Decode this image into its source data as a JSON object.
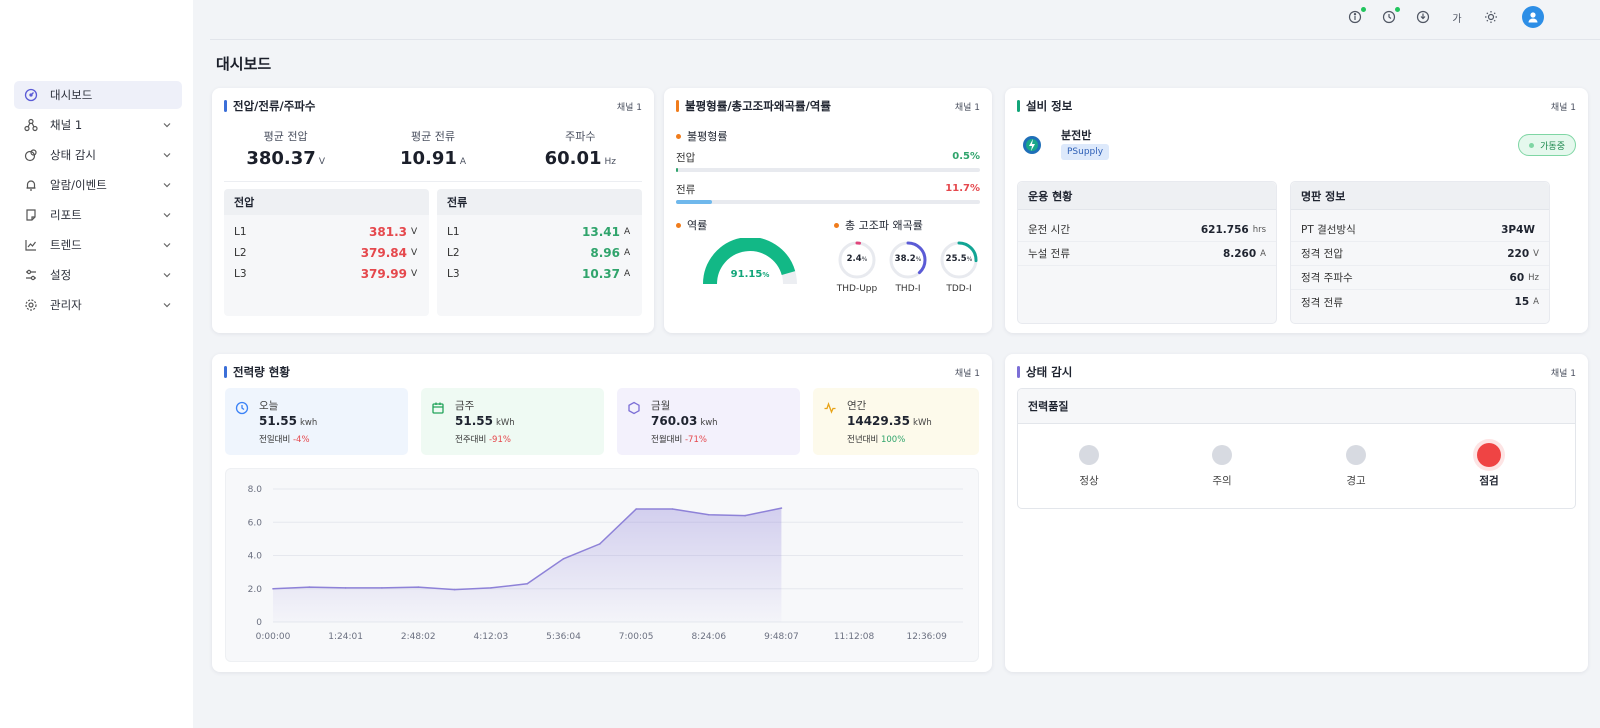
{
  "sidebar": {
    "items": [
      {
        "label": "대시보드",
        "active": true
      },
      {
        "label": "채널 1"
      },
      {
        "label": "상태 감시"
      },
      {
        "label": "알람/이벤트"
      },
      {
        "label": "리포트"
      },
      {
        "label": "트렌드"
      },
      {
        "label": "설정"
      },
      {
        "label": "관리자"
      }
    ]
  },
  "topbar": {
    "lang_label": "가"
  },
  "page_title": "대시보드",
  "vc": {
    "title": "전압/전류/주파수",
    "channel": "채널 1",
    "avg_voltage_label": "평균 전압",
    "avg_voltage": "380.37",
    "avg_voltage_unit": "V",
    "avg_current_label": "평균 전류",
    "avg_current": "10.91",
    "avg_current_unit": "A",
    "freq_label": "주파수",
    "freq": "60.01",
    "freq_unit": "Hz",
    "voltage_header": "전압",
    "current_header": "전류",
    "voltage_rows": [
      {
        "phase": "L1",
        "value": "381.3",
        "unit": "V"
      },
      {
        "phase": "L2",
        "value": "379.84",
        "unit": "V"
      },
      {
        "phase": "L3",
        "value": "379.99",
        "unit": "V"
      }
    ],
    "current_rows": [
      {
        "phase": "L1",
        "value": "13.41",
        "unit": "A"
      },
      {
        "phase": "L2",
        "value": "8.96",
        "unit": "A"
      },
      {
        "phase": "L3",
        "value": "10.37",
        "unit": "A"
      }
    ]
  },
  "quality": {
    "title": "불평형률/총고조파왜곡률/역률",
    "channel": "채널 1",
    "unbalance_label": "불평형률",
    "voltage_label": "전압",
    "voltage_value": "0.5%",
    "voltage_fraction": 0.005,
    "current_label": "전류",
    "current_value": "11.7%",
    "current_fraction": 0.117,
    "pf_label": "역률",
    "pf_value": "91.15",
    "pf_unit": "%",
    "pf_fraction": 0.9115,
    "thd_label": "총 고조파 왜곡률",
    "rings": [
      {
        "value": "2.4",
        "unit": "%",
        "label": "THD-Upp",
        "fraction": 0.024,
        "color": "#e0457b"
      },
      {
        "value": "38.2",
        "unit": "%",
        "label": "THD-I",
        "fraction": 0.382,
        "color": "#5b5bd6"
      },
      {
        "value": "25.5",
        "unit": "%",
        "label": "TDD-I",
        "fraction": 0.255,
        "color": "#12a594"
      }
    ]
  },
  "equipment": {
    "title": "설비 정보",
    "channel": "채널 1",
    "name": "분전반",
    "tag": "PSupply",
    "status": "가동중",
    "ops_header": "운용 현황",
    "ops_rows": [
      {
        "label": "운전 시간",
        "value": "621.756",
        "unit": "hrs"
      },
      {
        "label": "누설 전류",
        "value": "8.260",
        "unit": "A"
      }
    ],
    "plate_header": "명판 정보",
    "plate_rows": [
      {
        "label": "PT 결선방식",
        "value": "3P4W",
        "unit": ""
      },
      {
        "label": "정격 전압",
        "value": "220",
        "unit": "V"
      },
      {
        "label": "정격 주파수",
        "value": "60",
        "unit": "Hz"
      },
      {
        "label": "정격 전류",
        "value": "15",
        "unit": "A"
      }
    ]
  },
  "energy": {
    "title": "전력량 현황",
    "channel": "채널 1",
    "kpis": [
      {
        "label": "오늘",
        "value": "51.55",
        "unit": "kwh",
        "cmp_label": "전일대비",
        "cmp_value": "-4%",
        "icon": "clock-icon"
      },
      {
        "label": "금주",
        "value": "51.55",
        "unit": "kWh",
        "cmp_label": "전주대비",
        "cmp_value": "-91%",
        "icon": "calendar-icon"
      },
      {
        "label": "금월",
        "value": "760.03",
        "unit": "kwh",
        "cmp_label": "전월대비",
        "cmp_value": "-71%",
        "icon": "hexagon-icon"
      },
      {
        "label": "연간",
        "value": "14429.35",
        "unit": "kWh",
        "cmp_label": "전년대비",
        "cmp_value": "100%",
        "icon": "activity-icon"
      }
    ]
  },
  "monitor": {
    "title": "상태 감시",
    "channel": "채널 1",
    "pq_header": "전력품질",
    "lamps": [
      {
        "label": "정상",
        "active": false
      },
      {
        "label": "주의",
        "active": false
      },
      {
        "label": "경고",
        "active": false
      },
      {
        "label": "점검",
        "active": true
      }
    ]
  },
  "colors": {
    "accent": "#5b5bd6",
    "good": "#30a46c",
    "bad": "#e5484d",
    "orange": "#f07c1c",
    "gauge": "#12b886"
  },
  "chart_data": {
    "type": "area",
    "x": [
      "0:00:00",
      "0:41:20",
      "1:24:01",
      "2:06:00",
      "2:48:02",
      "3:30:00",
      "4:12:03",
      "4:54:00",
      "5:36:04",
      "6:18:00",
      "7:00:05",
      "7:42:00",
      "8:24:06",
      "9:06:00",
      "9:48:07",
      "10:30:00",
      "11:12:08",
      "11:54:00",
      "12:36:09",
      "13:18:00"
    ],
    "x_ticks": [
      "0:00:00",
      "1:24:01",
      "2:48:02",
      "4:12:03",
      "5:36:04",
      "7:00:05",
      "8:24:06",
      "9:48:07",
      "11:12:08",
      "12:36:09"
    ],
    "values": [
      2.0,
      2.1,
      2.05,
      2.05,
      2.1,
      1.95,
      2.05,
      2.3,
      3.8,
      4.7,
      6.8,
      6.8,
      6.45,
      6.4,
      6.85
    ],
    "y_ticks": [
      "8.0",
      "6.0",
      "4.0",
      "2.0",
      "0"
    ],
    "ylim": [
      0,
      8
    ],
    "grid": true,
    "color": "#8e82d8"
  }
}
